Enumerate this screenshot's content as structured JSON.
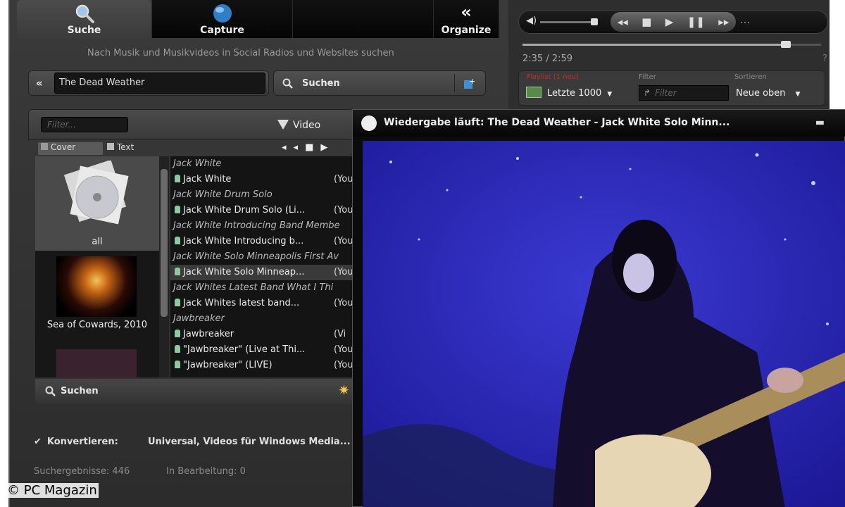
{
  "tabs": [
    {
      "label": "Suche",
      "icon": "magnifier-icon"
    },
    {
      "label": "Capture",
      "icon": "globe-icon"
    },
    {
      "label": "Organize",
      "icon": "double-chevron-icon"
    }
  ],
  "search": {
    "hint": "Nach Musik und Musikvideos in Social Radios und Websites suchen",
    "query": "The Dead Weather",
    "button": "Suchen"
  },
  "player": {
    "time": "2:35 / 2:59",
    "question": "?",
    "playlist_label": "Playlist (1 neu)",
    "playlist_value": "Letzte 1000",
    "filter_label": "Filter",
    "filter_placeholder": "Filter",
    "sort_label": "Sortieren",
    "sort_value": "Neue oben"
  },
  "results": {
    "filter_placeholder": "Filter...",
    "video_button": "Video",
    "cover_tab": "Cover",
    "text_tab": "Text",
    "covers": [
      {
        "label": "all"
      },
      {
        "label": "Sea of Cowards, 2010"
      }
    ],
    "rows": [
      {
        "type": "group",
        "text": "Jack White"
      },
      {
        "type": "item",
        "text": "Jack White",
        "source": "(YouT"
      },
      {
        "type": "group",
        "text": "Jack White Drum Solo"
      },
      {
        "type": "item",
        "text": "Jack White Drum Solo (Li...",
        "source": "(YouT"
      },
      {
        "type": "group",
        "text": "Jack White Introducing Band Membe"
      },
      {
        "type": "item",
        "text": "Jack White Introducing b...",
        "source": "(YouT"
      },
      {
        "type": "group",
        "text": "Jack White Solo Minneapolis First Av"
      },
      {
        "type": "item",
        "text": "Jack White Solo Minneap...",
        "source": "(YouT",
        "selected": true
      },
      {
        "type": "group",
        "text": "Jack Whites Latest Band What I Thi"
      },
      {
        "type": "item",
        "text": "Jack Whites latest band...",
        "source": "(YouT"
      },
      {
        "type": "group",
        "text": "Jawbreaker"
      },
      {
        "type": "item",
        "text": "Jawbreaker",
        "source": "(Vi"
      },
      {
        "type": "item",
        "text": "\"Jawbreaker\" (Live at Thi...",
        "source": "(YouT"
      },
      {
        "type": "item",
        "text": "\"Jawbreaker\" (LIVE)",
        "source": "(YouT"
      }
    ],
    "search_button": "Suchen"
  },
  "convert": {
    "label": "Konvertieren:",
    "value": "Universal, Videos für Windows Media..."
  },
  "status": {
    "results": "Suchergebnisse: 446",
    "processing": "In Bearbeitung: 0"
  },
  "video": {
    "title": "Wiedergabe läuft: The Dead Weather - Jack White Solo Minn..."
  },
  "credit": "© PC Magazin"
}
